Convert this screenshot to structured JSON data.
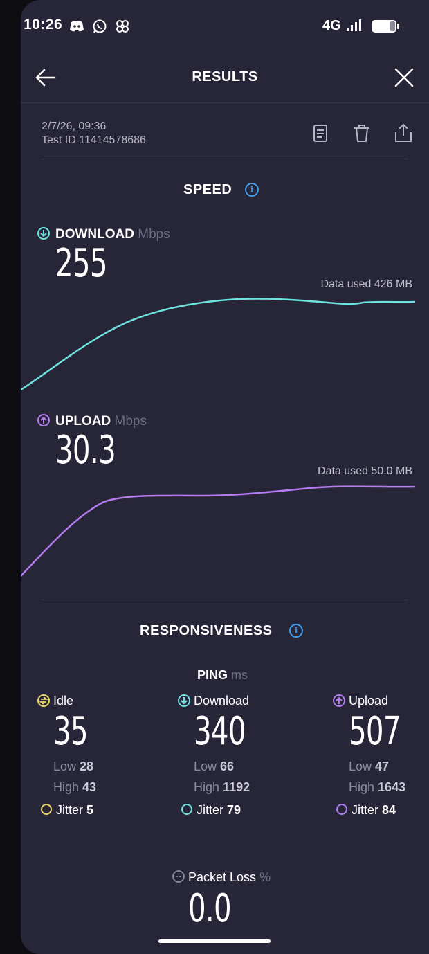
{
  "status_bar": {
    "time": "10:26",
    "network": "4G"
  },
  "header": {
    "title": "RESULTS"
  },
  "meta": {
    "date": "2/7/26, 09:36",
    "test_id": "Test ID 11414578686"
  },
  "speed": {
    "title": "SPEED",
    "download": {
      "label": "DOWNLOAD",
      "unit": "Mbps",
      "value": "255",
      "data_used": "Data used 426 MB",
      "color": "#6ee4e0"
    },
    "upload": {
      "label": "UPLOAD",
      "unit": "Mbps",
      "value": "30.3",
      "data_used": "Data used 50.0 MB",
      "color": "#b57cf2"
    }
  },
  "responsiveness": {
    "title": "RESPONSIVENESS",
    "ping_label": "PING",
    "ping_unit": "ms",
    "columns": [
      {
        "label": "Idle",
        "value": "35",
        "low_label": "Low",
        "low": "28",
        "high_label": "High",
        "high": "43",
        "jitter_label": "Jitter",
        "jitter": "5",
        "color": "#ecd86b"
      },
      {
        "label": "Download",
        "value": "340",
        "low_label": "Low",
        "low": "66",
        "high_label": "High",
        "high": "1192",
        "jitter_label": "Jitter",
        "jitter": "79",
        "color": "#6ee4e0"
      },
      {
        "label": "Upload",
        "value": "507",
        "low_label": "Low",
        "low": "47",
        "high_label": "High",
        "high": "1643",
        "jitter_label": "Jitter",
        "jitter": "84",
        "color": "#b57cf2"
      }
    ],
    "packet_loss": {
      "label": "Packet Loss",
      "unit": "%",
      "value": "0.0"
    }
  }
}
